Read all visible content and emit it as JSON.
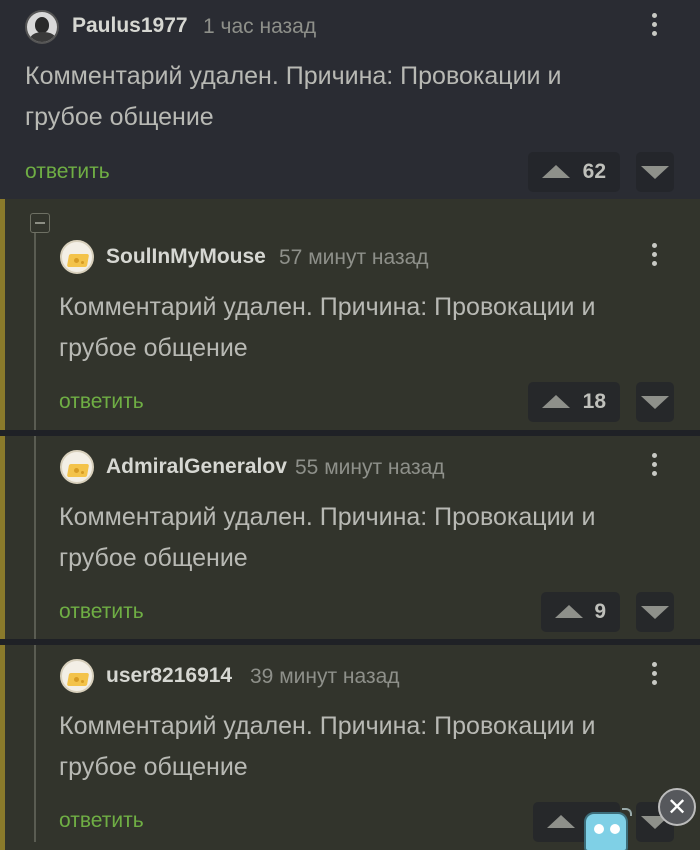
{
  "colors": {
    "accent_link": "#6fae44",
    "thread_marker": "#8a7a2b",
    "background": "#1f2126"
  },
  "comments": [
    {
      "username": "Paulus1977",
      "time": "1 час назад",
      "text": "Комментарий удален. Причина: Провокации и грубое общение",
      "reply_label": "ответить",
      "rating": "62",
      "avatar": "user-photo-avatar"
    },
    {
      "username": "SoulInMyMouse",
      "time": "57 минут назад",
      "text": "Комментарий удален. Причина: Провокации и грубое общение",
      "reply_label": "ответить",
      "rating": "18",
      "avatar": "cheese-avatar"
    },
    {
      "username": "AdmiralGeneralov",
      "time": "55 минут назад",
      "text": "Комментарий удален. Причина: Провокации и грубое общение",
      "reply_label": "ответить",
      "rating": "9",
      "avatar": "cheese-avatar"
    },
    {
      "username": "user8216914",
      "time": "39 минут назад",
      "text": "Комментарий удален. Причина: Провокации и грубое общение",
      "reply_label": "ответить",
      "rating": "",
      "avatar": "cheese-avatar"
    }
  ],
  "icons": {
    "more": "kebab-menu-icon",
    "upvote": "triangle-up-icon",
    "downvote": "triangle-down-icon",
    "collapse": "minus-box-icon",
    "close": "close-icon",
    "mascot": "robot-mascot-icon"
  },
  "close_glyph": "✕"
}
